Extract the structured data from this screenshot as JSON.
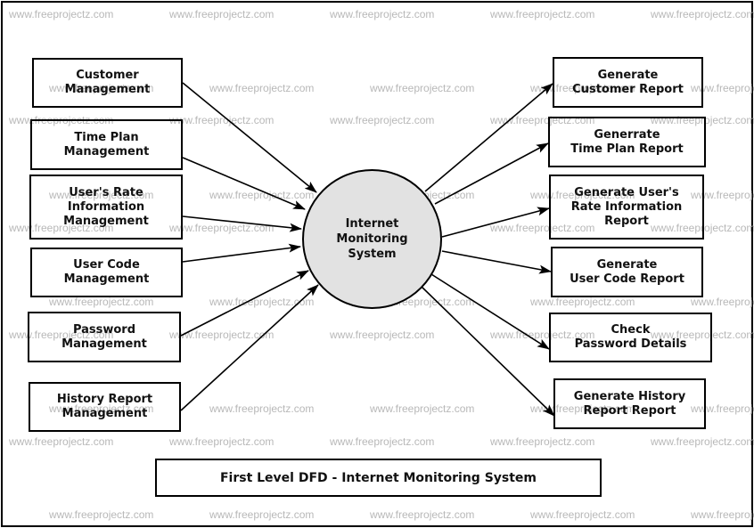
{
  "diagram": {
    "title": "First Level DFD - Internet Monitoring System",
    "watermark": "www.freeprojectz.com",
    "central_process": {
      "label": "Internet\nMonitoring\nSystem",
      "fill": "#e2e2e2"
    },
    "inputs": [
      {
        "id": "customer-management",
        "label": "Customer\nManagement"
      },
      {
        "id": "time-plan-management",
        "label": "Time Plan\nManagement"
      },
      {
        "id": "users-rate-information-management",
        "label": "User's Rate\nInformation\nManagement"
      },
      {
        "id": "user-code-management",
        "label": "User Code\nManagement"
      },
      {
        "id": "password-management",
        "label": "Password\nManagement"
      },
      {
        "id": "history-report-management",
        "label": "History Report\nManagement"
      }
    ],
    "outputs": [
      {
        "id": "generate-customer-report",
        "label": "Generate\nCustomer Report"
      },
      {
        "id": "generrate-time-plan-report",
        "label": "Generrate\nTime Plan Report"
      },
      {
        "id": "generate-users-rate-information-report",
        "label": "Generate User's\nRate Information\nReport"
      },
      {
        "id": "generate-user-code-report",
        "label": "Generate\nUser Code Report"
      },
      {
        "id": "check-password-details",
        "label": "Check\nPassword Details"
      },
      {
        "id": "generate-history-report-report",
        "label": "Generate History\nReport Report"
      }
    ],
    "flows": [
      {
        "from": "customer-management",
        "to": "central-process"
      },
      {
        "from": "time-plan-management",
        "to": "central-process"
      },
      {
        "from": "users-rate-information-management",
        "to": "central-process"
      },
      {
        "from": "user-code-management",
        "to": "central-process"
      },
      {
        "from": "password-management",
        "to": "central-process"
      },
      {
        "from": "history-report-management",
        "to": "central-process"
      },
      {
        "from": "central-process",
        "to": "generate-customer-report"
      },
      {
        "from": "central-process",
        "to": "generrate-time-plan-report"
      },
      {
        "from": "central-process",
        "to": "generate-users-rate-information-report"
      },
      {
        "from": "central-process",
        "to": "generate-user-code-report"
      },
      {
        "from": "central-process",
        "to": "check-password-details"
      },
      {
        "from": "central-process",
        "to": "generate-history-report-report"
      }
    ]
  }
}
